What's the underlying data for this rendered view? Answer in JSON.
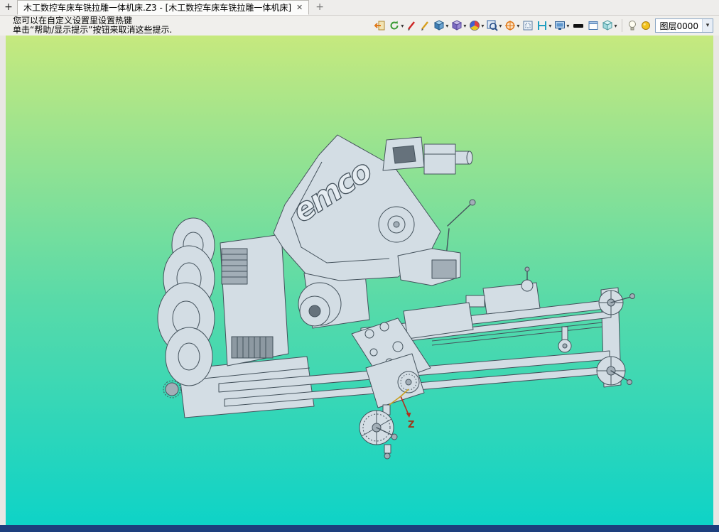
{
  "tab_bar": {
    "pin_glyph": "+",
    "tab": {
      "title": "木工数控车床车铣拉雕一体机床.Z3 - [木工数控车床车铣拉雕一体机床]",
      "close_glyph": "✕"
    },
    "new_tab_glyph": "+"
  },
  "hint": {
    "line1": "您可以在自定义设置里设置热键",
    "line2": "单击“帮助/显示提示”按钮来取消这些提示."
  },
  "toolbar": {
    "dropdown_glyph": "▾",
    "icons": [
      {
        "name": "exit-icon",
        "dropdown": false
      },
      {
        "name": "refresh-view-icon",
        "dropdown": true
      },
      {
        "name": "red-pen-icon",
        "dropdown": false
      },
      {
        "name": "gold-pen-icon",
        "dropdown": false
      },
      {
        "name": "shaded-cube-icon",
        "dropdown": true
      },
      {
        "name": "wireframe-cube-icon",
        "dropdown": true
      },
      {
        "name": "color-wheel-icon",
        "dropdown": true
      },
      {
        "name": "zoom-window-icon",
        "dropdown": true
      },
      {
        "name": "orient-compass-icon",
        "dropdown": true
      },
      {
        "name": "viewport-frame-icon",
        "dropdown": false
      },
      {
        "name": "section-ruler-icon",
        "dropdown": true
      },
      {
        "name": "display-monitor-icon",
        "dropdown": true
      },
      {
        "name": "black-plane-icon",
        "dropdown": false
      },
      {
        "name": "white-panel-icon",
        "dropdown": false
      },
      {
        "name": "cyan-cube-icon",
        "dropdown": true
      },
      {
        "name": "bulb-icon",
        "dropdown": false
      },
      {
        "name": "yellow-ball-icon",
        "dropdown": false
      }
    ],
    "layer_combo": {
      "value": "图层0000"
    }
  },
  "viewport": {
    "background_top": "#c6e97e",
    "background_bottom": "#0ed3c7",
    "model_logo": "emco",
    "axis_label_z": "Z"
  }
}
